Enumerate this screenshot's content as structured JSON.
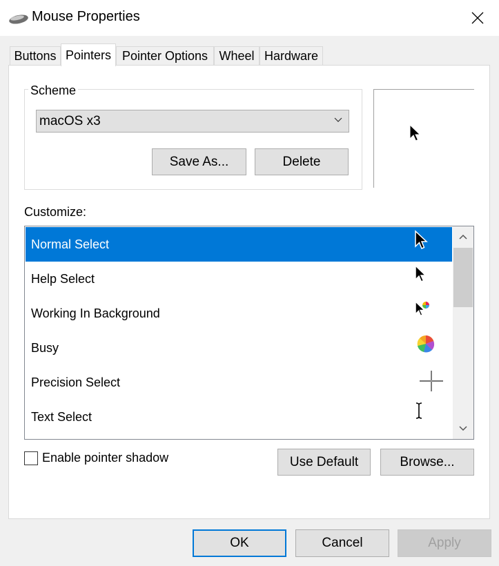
{
  "window": {
    "title": "Mouse Properties"
  },
  "tabs": [
    {
      "label": "Buttons"
    },
    {
      "label": "Pointers"
    },
    {
      "label": "Pointer Options"
    },
    {
      "label": "Wheel"
    },
    {
      "label": "Hardware"
    }
  ],
  "active_tab": "Pointers",
  "scheme": {
    "label": "Scheme",
    "selected": "macOS x3",
    "save_as": "Save As...",
    "delete": "Delete"
  },
  "customize": {
    "label": "Customize:",
    "items": [
      {
        "label": "Normal Select",
        "icon": "arrow-cursor-icon",
        "selected": true
      },
      {
        "label": "Help Select",
        "icon": "arrow-cursor-icon"
      },
      {
        "label": "Working In Background",
        "icon": "arrow-busy-cursor-icon"
      },
      {
        "label": "Busy",
        "icon": "spinner-cursor-icon"
      },
      {
        "label": "Precision Select",
        "icon": "crosshair-cursor-icon"
      },
      {
        "label": "Text Select",
        "icon": "ibeam-cursor-icon"
      }
    ]
  },
  "pointer_shadow": {
    "label": "Enable pointer shadow",
    "checked": false
  },
  "buttons": {
    "use_default": "Use Default",
    "browse": "Browse...",
    "ok": "OK",
    "cancel": "Cancel",
    "apply": "Apply"
  },
  "colors": {
    "accent": "#0078d7",
    "panel": "#ffffff",
    "dialog": "#f0f0f0"
  }
}
